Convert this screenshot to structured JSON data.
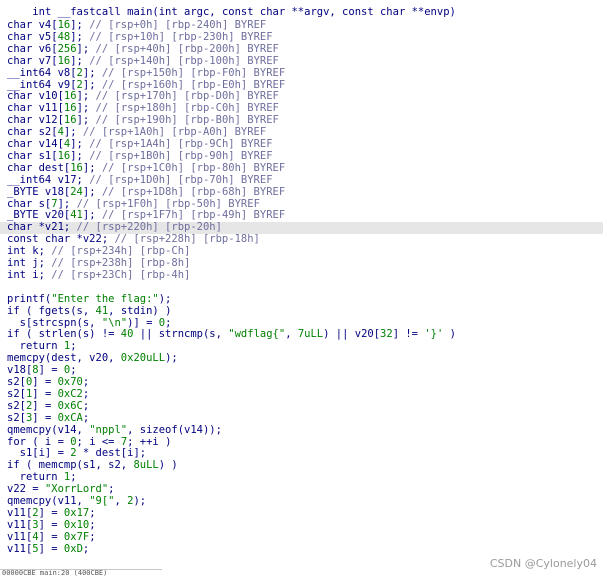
{
  "header": "int __fastcall main(int argc, const char **argv, const char **envp)",
  "lines": [
    {
      "text": "char v4[16]; // [rsp+0h] [rbp-240h] BYREF"
    },
    {
      "text": "char v5[48]; // [rsp+10h] [rbp-230h] BYREF"
    },
    {
      "text": "char v6[256]; // [rsp+40h] [rbp-200h] BYREF"
    },
    {
      "text": "char v7[16]; // [rsp+140h] [rbp-100h] BYREF"
    },
    {
      "text": "__int64 v8[2]; // [rsp+150h] [rbp-F0h] BYREF"
    },
    {
      "text": "__int64 v9[2]; // [rsp+160h] [rbp-E0h] BYREF"
    },
    {
      "text": "char v10[16]; // [rsp+170h] [rbp-D0h] BYREF"
    },
    {
      "text": "char v11[16]; // [rsp+180h] [rbp-C0h] BYREF"
    },
    {
      "text": "char v12[16]; // [rsp+190h] [rbp-B0h] BYREF"
    },
    {
      "text": "char s2[4]; // [rsp+1A0h] [rbp-A0h] BYREF"
    },
    {
      "text": "char v14[4]; // [rsp+1A4h] [rbp-9Ch] BYREF"
    },
    {
      "text": "char s1[16]; // [rsp+1B0h] [rbp-90h] BYREF"
    },
    {
      "text": "char dest[16]; // [rsp+1C0h] [rbp-80h] BYREF"
    },
    {
      "text": "__int64 v17; // [rsp+1D0h] [rbp-70h] BYREF"
    },
    {
      "text": "_BYTE v18[24]; // [rsp+1D8h] [rbp-68h] BYREF"
    },
    {
      "text": "char s[7]; // [rsp+1F0h] [rbp-50h] BYREF"
    },
    {
      "text": "_BYTE v20[41]; // [rsp+1F7h] [rbp-49h] BYREF"
    },
    {
      "text": "char *v21; // [rsp+220h] [rbp-20h]"
    },
    {
      "text": "const char *v22; // [rsp+228h] [rbp-18h]"
    },
    {
      "text": "int k; // [rsp+234h] [rbp-Ch]"
    },
    {
      "text": "int j; // [rsp+238h] [rbp-8h]"
    },
    {
      "text": "int i; // [rsp+23Ch] [rbp-4h]"
    },
    {
      "text": ""
    },
    {
      "text": "printf(\"Enter the flag:\");"
    },
    {
      "text": "if ( fgets(s, 41, stdin) )"
    },
    {
      "text": "  s[strcspn(s, \"\\n\")] = 0;"
    },
    {
      "text": "if ( strlen(s) != 40 || strncmp(s, \"wdflag{\", 7uLL) || v20[32] != '}' )"
    },
    {
      "text": "  return 1;"
    },
    {
      "text": "memcpy(dest, v20, 0x20uLL);"
    },
    {
      "text": "v18[8] = 0;"
    },
    {
      "text": "s2[0] = 0x70;"
    },
    {
      "text": "s2[1] = 0xC2;"
    },
    {
      "text": "s2[2] = 0x6C;"
    },
    {
      "text": "s2[3] = 0xCA;"
    },
    {
      "text": "qmemcpy(v14, \"nppl\", sizeof(v14));"
    },
    {
      "text": "for ( i = 0; i <= 7; ++i )"
    },
    {
      "text": "  s1[i] = 2 * dest[i];"
    },
    {
      "text": "if ( memcmp(s1, s2, 8uLL) )"
    },
    {
      "text": "  return 1;"
    },
    {
      "text": "v22 = \"XorrLord\";"
    },
    {
      "text": "qmemcpy(v11, \"9[\", 2);"
    },
    {
      "text": "v11[2] = 0x17;"
    },
    {
      "text": "v11[3] = 0x10;"
    },
    {
      "text": "v11[4] = 0x7F;"
    },
    {
      "text": "v11[5] = 0xD;"
    }
  ],
  "highlighted_line": 17,
  "watermark": "CSDN @Cylonely04",
  "status": "00000CBE main:20 (400CBE)"
}
